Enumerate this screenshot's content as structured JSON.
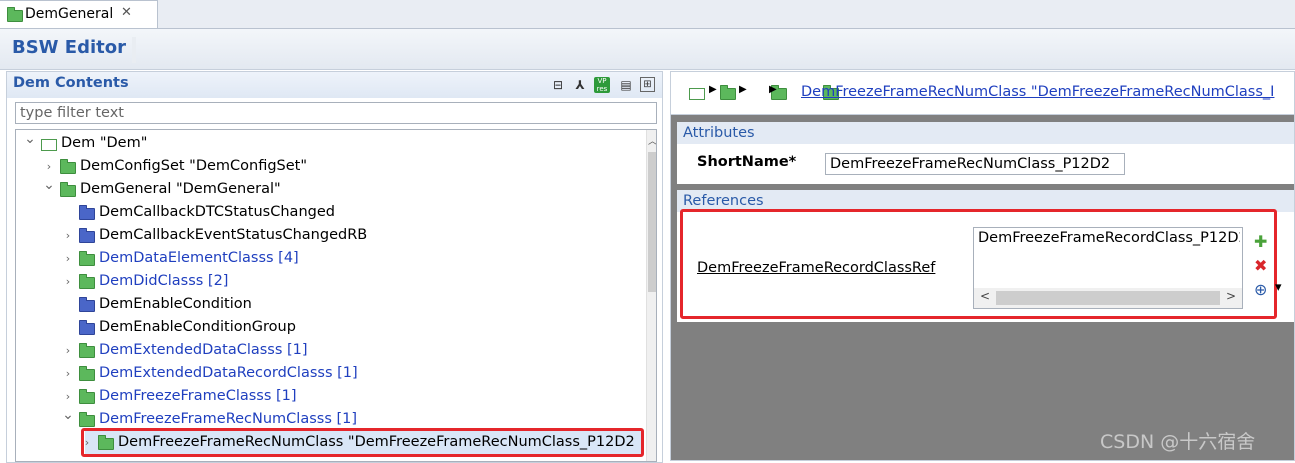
{
  "tab": {
    "label": "DemGeneral",
    "close": "✕",
    "icon": "folder-icon"
  },
  "editor": {
    "title": "BSW Editor"
  },
  "left_panel": {
    "title": "Dem Contents",
    "filter_placeholder": "type filter text",
    "toolbar_icons": [
      "collapse-all-icon",
      "hierarchy-icon",
      "vp-res-icon",
      "document-icon",
      "table-settings-icon"
    ],
    "vp_label": "VP",
    "res_label": "res",
    "tree": [
      {
        "label": "Dem \"Dem\"",
        "depth": 0,
        "expander": "expanded",
        "icon": "box",
        "color": "black"
      },
      {
        "label": "DemConfigSet \"DemConfigSet\"",
        "depth": 1,
        "expander": "collapsed",
        "icon": "green-folder",
        "color": "black"
      },
      {
        "label": "DemGeneral \"DemGeneral\"",
        "depth": 1,
        "expander": "expanded",
        "icon": "green-folder",
        "color": "black"
      },
      {
        "label": "DemCallbackDTCStatusChanged",
        "depth": 2,
        "expander": "none",
        "icon": "blue-folder",
        "color": "black"
      },
      {
        "label": "DemCallbackEventStatusChangedRB",
        "depth": 2,
        "expander": "collapsed",
        "icon": "blue-folder",
        "color": "black"
      },
      {
        "label": "DemDataElementClasss [4]",
        "depth": 2,
        "expander": "collapsed",
        "icon": "green-folder",
        "color": "blue"
      },
      {
        "label": "DemDidClasss [2]",
        "depth": 2,
        "expander": "collapsed",
        "icon": "green-folder",
        "color": "blue"
      },
      {
        "label": "DemEnableCondition",
        "depth": 2,
        "expander": "none",
        "icon": "blue-folder",
        "color": "black"
      },
      {
        "label": "DemEnableConditionGroup",
        "depth": 2,
        "expander": "none",
        "icon": "blue-folder",
        "color": "black"
      },
      {
        "label": "DemExtendedDataClasss [1]",
        "depth": 2,
        "expander": "collapsed",
        "icon": "green-folder",
        "color": "blue"
      },
      {
        "label": "DemExtendedDataRecordClasss [1]",
        "depth": 2,
        "expander": "collapsed",
        "icon": "green-folder",
        "color": "blue"
      },
      {
        "label": "DemFreezeFrameClasss [1]",
        "depth": 2,
        "expander": "collapsed",
        "icon": "green-folder",
        "color": "blue"
      },
      {
        "label": "DemFreezeFrameRecNumClasss [1]",
        "depth": 2,
        "expander": "expanded",
        "icon": "green-folder",
        "color": "blue"
      },
      {
        "label": "DemFreezeFrameRecNumClass \"DemFreezeFrameRecNumClass_P12D2",
        "depth": 3,
        "expander": "collapsed",
        "icon": "green-folder",
        "color": "black",
        "selected": true
      }
    ]
  },
  "right_panel": {
    "breadcrumb_link": "DemFreezeFrameRecNumClass \"DemFreezeFrameRecNumClass_I",
    "attributes": {
      "header": "Attributes",
      "shortname_label": "ShortName*",
      "shortname_value": "DemFreezeFrameRecNumClass_P12D2"
    },
    "references": {
      "header": "References",
      "ref_label": "DemFreezeFrameRecordClassRef",
      "ref_value": "DemFreezeFrameRecordClass_P12D2",
      "add": "✚",
      "remove": "✖",
      "browse": "⊕",
      "dropdown": "▾"
    }
  },
  "watermark": "CSDN @十六宿舍",
  "colors": {
    "accent": "#2a5aa8",
    "link": "#1f3fbf",
    "highlight": "#e5262b",
    "folder_green": "#5cb85c",
    "folder_blue": "#4a66c8"
  }
}
